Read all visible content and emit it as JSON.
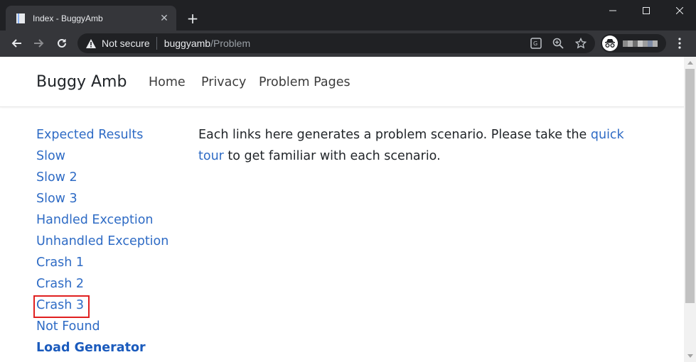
{
  "browser": {
    "tab_title": "Index - BuggyAmb",
    "security_label": "Not secure",
    "url_host": "buggyamb",
    "url_path": "/Problem"
  },
  "navbar": {
    "brand": "Buggy Amb",
    "links": [
      "Home",
      "Privacy",
      "Problem Pages"
    ]
  },
  "sidebar": {
    "items": [
      {
        "label": "Expected Results"
      },
      {
        "label": "Slow"
      },
      {
        "label": "Slow 2"
      },
      {
        "label": "Slow 3"
      },
      {
        "label": "Handled Exception"
      },
      {
        "label": "Unhandled Exception"
      },
      {
        "label": "Crash 1"
      },
      {
        "label": "Crash 2"
      },
      {
        "label": "Crash 3"
      },
      {
        "label": "Not Found"
      },
      {
        "label": "Load Generator"
      }
    ]
  },
  "main": {
    "text_before": "Each links here generates a problem scenario. Please take the ",
    "link_text": "quick tour",
    "text_after": " to get familiar with each scenario."
  },
  "colors": {
    "link": "#2e6bc5",
    "highlight": "#e02020",
    "chrome_dark": "#202124",
    "chrome_tab": "#35363a"
  }
}
